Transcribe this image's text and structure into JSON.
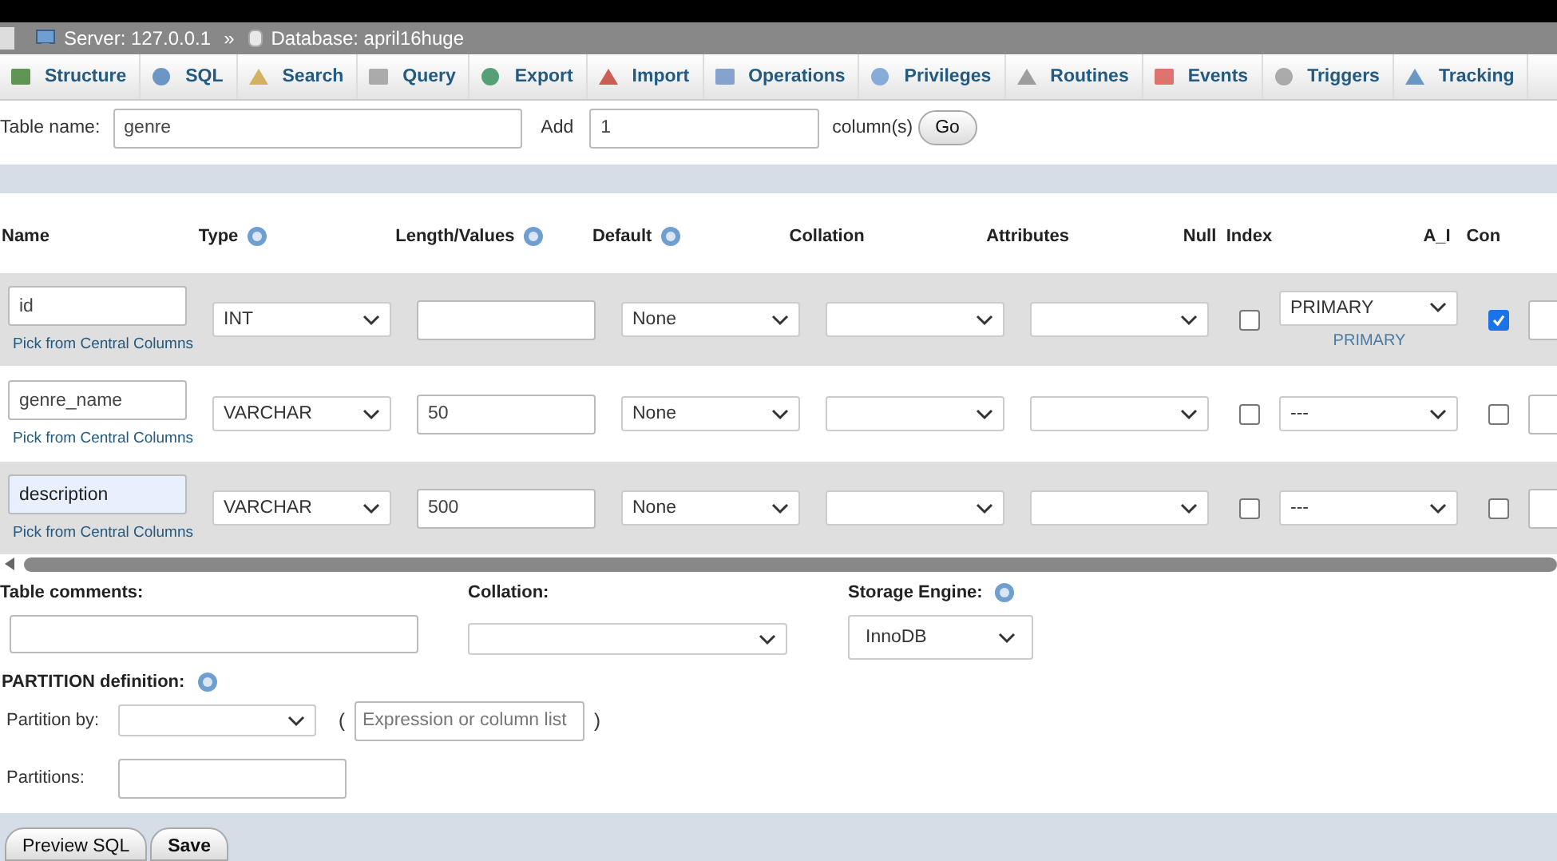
{
  "breadcrumb": {
    "server": "Server: 127.0.0.1",
    "separator": "»",
    "database": "Database: april16huge"
  },
  "tabs": [
    {
      "label": "Structure"
    },
    {
      "label": "SQL"
    },
    {
      "label": "Search"
    },
    {
      "label": "Query"
    },
    {
      "label": "Export"
    },
    {
      "label": "Import"
    },
    {
      "label": "Operations"
    },
    {
      "label": "Privileges"
    },
    {
      "label": "Routines"
    },
    {
      "label": "Events"
    },
    {
      "label": "Triggers"
    },
    {
      "label": "Tracking"
    }
  ],
  "table_name": {
    "label": "Table name:",
    "value": "genre",
    "add_label": "Add",
    "add_value": "1",
    "unit": "column(s)",
    "go": "Go"
  },
  "columns": [
    "Name",
    "Type",
    "Length/Values",
    "Default",
    "Collation",
    "Attributes",
    "Null",
    "Index",
    "A_I",
    "Con"
  ],
  "rows": [
    {
      "name": "id",
      "link": "Pick from Central Columns",
      "type": "INT",
      "length": "",
      "default": "None",
      "null": false,
      "index": "PRIMARY",
      "index_note": "PRIMARY",
      "ai": true,
      "highlighted": false
    },
    {
      "name": "genre_name",
      "link": "Pick from Central Columns",
      "type": "VARCHAR",
      "length": "50",
      "default": "None",
      "null": false,
      "index": "---",
      "ai": false,
      "highlighted": false
    },
    {
      "name": "description",
      "link": "Pick from Central Columns",
      "type": "VARCHAR",
      "length": "500",
      "default": "None",
      "null": false,
      "index": "---",
      "ai": false,
      "highlighted": true
    }
  ],
  "table_options": {
    "comments_label": "Table comments:",
    "collation_label": "Collation:",
    "engine_label": "Storage Engine:",
    "engine": "InnoDB"
  },
  "partition": {
    "title": "PARTITION definition:",
    "by_label": "Partition by:",
    "open": "(",
    "expr_placeholder": "Expression or column list",
    "close": ")",
    "count_label": "Partitions:"
  },
  "buttons": [
    "Preview SQL",
    "Save"
  ]
}
